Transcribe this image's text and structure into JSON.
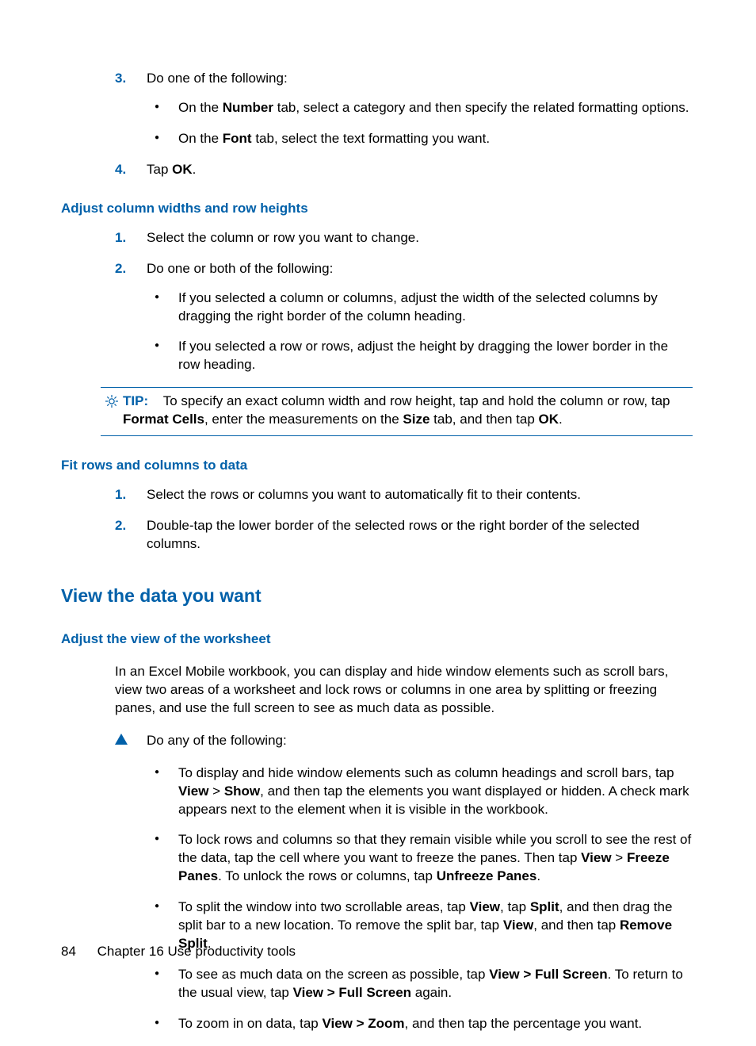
{
  "footer": {
    "page_number": "84",
    "chapter_label": "Chapter 16   Use productivity tools"
  },
  "top_steps": {
    "step3_num": "3.",
    "step3_text_a": "Do one of the following:",
    "step3_bullet1_a": "On the ",
    "step3_bullet1_b": "Number",
    "step3_bullet1_c": " tab, select a category and then specify the related formatting options.",
    "step3_bullet2_a": "On the ",
    "step3_bullet2_b": "Font",
    "step3_bullet2_c": " tab, select the text formatting you want.",
    "step4_num": "4.",
    "step4_a": "Tap ",
    "step4_b": "OK",
    "step4_c": "."
  },
  "heading_adjust": "Adjust column widths and row heights",
  "adjust": {
    "s1_num": "1.",
    "s1": "Select the column or row you want to change.",
    "s2_num": "2.",
    "s2": "Do one or both of the following:",
    "b1": "If you selected a column or columns, adjust the width of the selected columns by dragging the right border of the column heading.",
    "b2": "If you selected a row or rows, adjust the height by dragging the lower border in the row heading."
  },
  "tip": {
    "label": "TIP:",
    "t1": "To specify an exact column width and row height, tap and hold the column or row, tap ",
    "t2": "Format Cells",
    "t3": ", enter the measurements on the ",
    "t4": "Size",
    "t5": " tab, and then tap ",
    "t6": "OK",
    "t7": "."
  },
  "heading_fit": "Fit rows and columns to data",
  "fit": {
    "s1_num": "1.",
    "s1": "Select the rows or columns you want to automatically fit to their contents.",
    "s2_num": "2.",
    "s2": "Double-tap the lower border of the selected rows or the right border of the selected columns."
  },
  "heading_view": "View the data you want",
  "heading_adjust_view": "Adjust the view of the worksheet",
  "adjust_view_intro": "In an Excel Mobile workbook, you can display and hide window elements such as scroll bars, view two areas of a worksheet and lock rows or columns in one area by splitting or freezing panes, and use the full screen to see as much data as possible.",
  "do_any": "Do any of the following:",
  "view_bullets": {
    "b1_a": "To display and hide window elements such as column headings and scroll bars, tap ",
    "b1_b": "View",
    "b1_c": " > ",
    "b1_d": "Show",
    "b1_e": ", and then tap the elements you want displayed or hidden. A check mark appears next to the element when it is visible in the workbook.",
    "b2_a": "To lock rows and columns so that they remain visible while you scroll to see the rest of the data, tap the cell where you want to freeze the panes. Then tap ",
    "b2_b": "View",
    "b2_c": " > ",
    "b2_d": "Freeze Panes",
    "b2_e": ". To unlock the rows or columns, tap ",
    "b2_f": "Unfreeze Panes",
    "b2_g": ".",
    "b3_a": "To split the window into two scrollable areas, tap ",
    "b3_b": "View",
    "b3_c": ", tap ",
    "b3_d": "Split",
    "b3_e": ", and then drag the split bar to a new location. To remove the split bar, tap ",
    "b3_f": "View",
    "b3_g": ", and then tap ",
    "b3_h": "Remove Split",
    "b3_i": ".",
    "b4_a": "To see as much data on the screen as possible, tap ",
    "b4_b": "View > Full Screen",
    "b4_c": ". To return to the usual view, tap ",
    "b4_d": "View > Full Screen",
    "b4_e": " again.",
    "b5_a": "To zoom in on data, tap ",
    "b5_b": "View > Zoom",
    "b5_c": ", and then tap the percentage you want."
  }
}
